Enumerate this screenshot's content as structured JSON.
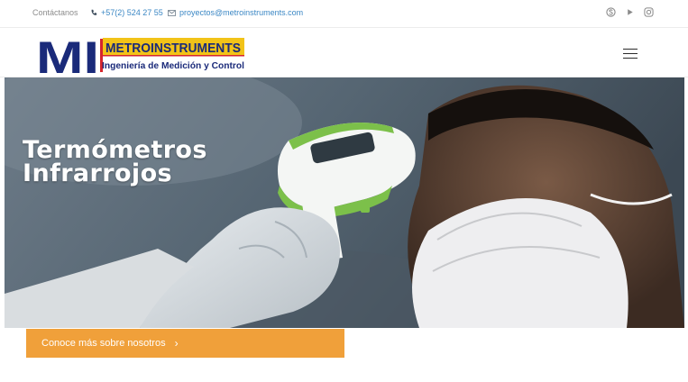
{
  "topbar": {
    "contact_label": "Contáctanos",
    "phone": "+57(2) 524 27 55",
    "email": "proyectos@metroinstruments.com",
    "social_icons": [
      "skype-icon",
      "play-icon",
      "instagram-icon"
    ]
  },
  "header": {
    "logo": {
      "monogram": "MI",
      "name": "METROINSTRUMENTS",
      "tagline": "Ingeniería de Medición y Control"
    },
    "menu_icon": "hamburger-icon"
  },
  "hero": {
    "title_line1": "Termómetros",
    "title_line2": "Infrarrojos"
  },
  "cta": {
    "label": "Conoce más sobre nosotros",
    "arrow": "›"
  },
  "colors": {
    "accent_orange": "#f0a03a",
    "link_blue": "#3b87c4",
    "logo_navy": "#1a2a7a",
    "logo_red": "#d6262c",
    "logo_yellow": "#f2c318"
  }
}
